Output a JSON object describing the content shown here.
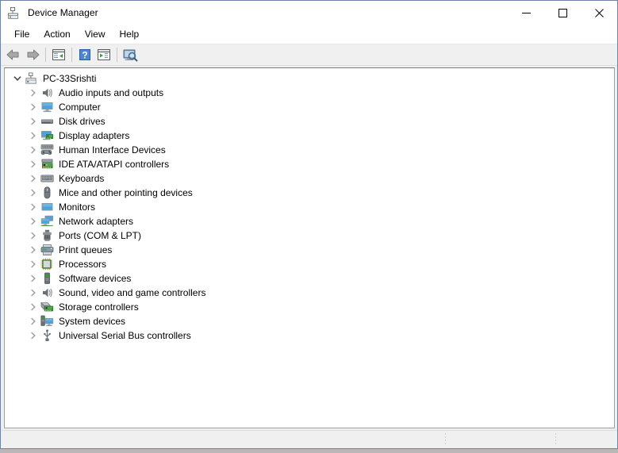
{
  "window": {
    "title": "Device Manager",
    "title_icon": "device-manager-icon",
    "controls": {
      "minimize": "minimize-icon",
      "maximize": "maximize-icon",
      "close": "close-icon"
    }
  },
  "menubar": {
    "items": [
      {
        "label": "File"
      },
      {
        "label": "Action"
      },
      {
        "label": "View"
      },
      {
        "label": "Help"
      }
    ]
  },
  "toolbar": {
    "buttons": [
      {
        "name": "back-arrow-icon",
        "tooltip": "Back"
      },
      {
        "name": "forward-arrow-icon",
        "tooltip": "Forward"
      },
      {
        "name": "separator-1"
      },
      {
        "name": "show-hide-console-tree-icon",
        "tooltip": "Show/Hide Console Tree"
      },
      {
        "name": "separator-2"
      },
      {
        "name": "help-icon",
        "tooltip": "Help"
      },
      {
        "name": "properties-icon",
        "tooltip": "Properties"
      },
      {
        "name": "separator-3"
      },
      {
        "name": "scan-for-hardware-changes-icon",
        "tooltip": "Scan for hardware changes"
      }
    ]
  },
  "tree": {
    "root": {
      "label": "PC-33Srishti",
      "icon": "computer-root-icon",
      "expanded": true,
      "twisty": "chevron-down-icon"
    },
    "children": [
      {
        "label": "Audio inputs and outputs",
        "icon": "speaker-icon",
        "twisty": "chevron-right-icon"
      },
      {
        "label": "Computer",
        "icon": "monitor-icon",
        "twisty": "chevron-right-icon"
      },
      {
        "label": "Disk drives",
        "icon": "disk-drive-icon",
        "twisty": "chevron-right-icon"
      },
      {
        "label": "Display adapters",
        "icon": "display-adapter-icon",
        "twisty": "chevron-right-icon"
      },
      {
        "label": "Human Interface Devices",
        "icon": "hid-gamepad-icon",
        "twisty": "chevron-right-icon"
      },
      {
        "label": "IDE ATA/ATAPI controllers",
        "icon": "ide-controller-icon",
        "twisty": "chevron-right-icon"
      },
      {
        "label": "Keyboards",
        "icon": "keyboard-icon",
        "twisty": "chevron-right-icon"
      },
      {
        "label": "Mice and other pointing devices",
        "icon": "mouse-icon",
        "twisty": "chevron-right-icon"
      },
      {
        "label": "Monitors",
        "icon": "monitor-screen-icon",
        "twisty": "chevron-right-icon"
      },
      {
        "label": "Network adapters",
        "icon": "network-adapter-icon",
        "twisty": "chevron-right-icon"
      },
      {
        "label": "Ports (COM & LPT)",
        "icon": "port-connector-icon",
        "twisty": "chevron-right-icon"
      },
      {
        "label": "Print queues",
        "icon": "printer-icon",
        "twisty": "chevron-right-icon"
      },
      {
        "label": "Processors",
        "icon": "processor-chip-icon",
        "twisty": "chevron-right-icon"
      },
      {
        "label": "Software devices",
        "icon": "software-device-icon",
        "twisty": "chevron-right-icon"
      },
      {
        "label": "Sound, video and game controllers",
        "icon": "speaker-icon",
        "twisty": "chevron-right-icon"
      },
      {
        "label": "Storage controllers",
        "icon": "storage-controller-icon",
        "twisty": "chevron-right-icon"
      },
      {
        "label": "System devices",
        "icon": "system-device-icon",
        "twisty": "chevron-right-icon"
      },
      {
        "label": "Universal Serial Bus controllers",
        "icon": "usb-icon",
        "twisty": "chevron-right-icon"
      }
    ]
  },
  "statusbar": {
    "panes": [
      {
        "text": ""
      },
      {
        "text": ""
      },
      {
        "text": ""
      }
    ]
  },
  "colors": {
    "window_border": "#6d86a8",
    "titlebar_bg": "#ffffff",
    "toolbar_bg": "#f0f0f0",
    "tree_bg": "#ffffff",
    "text": "#000000",
    "icon_blue": "#4ba3dd",
    "icon_green": "#3a9b35",
    "icon_gray": "#6d6d6d",
    "arrow_gray": "#8a8a8a"
  }
}
